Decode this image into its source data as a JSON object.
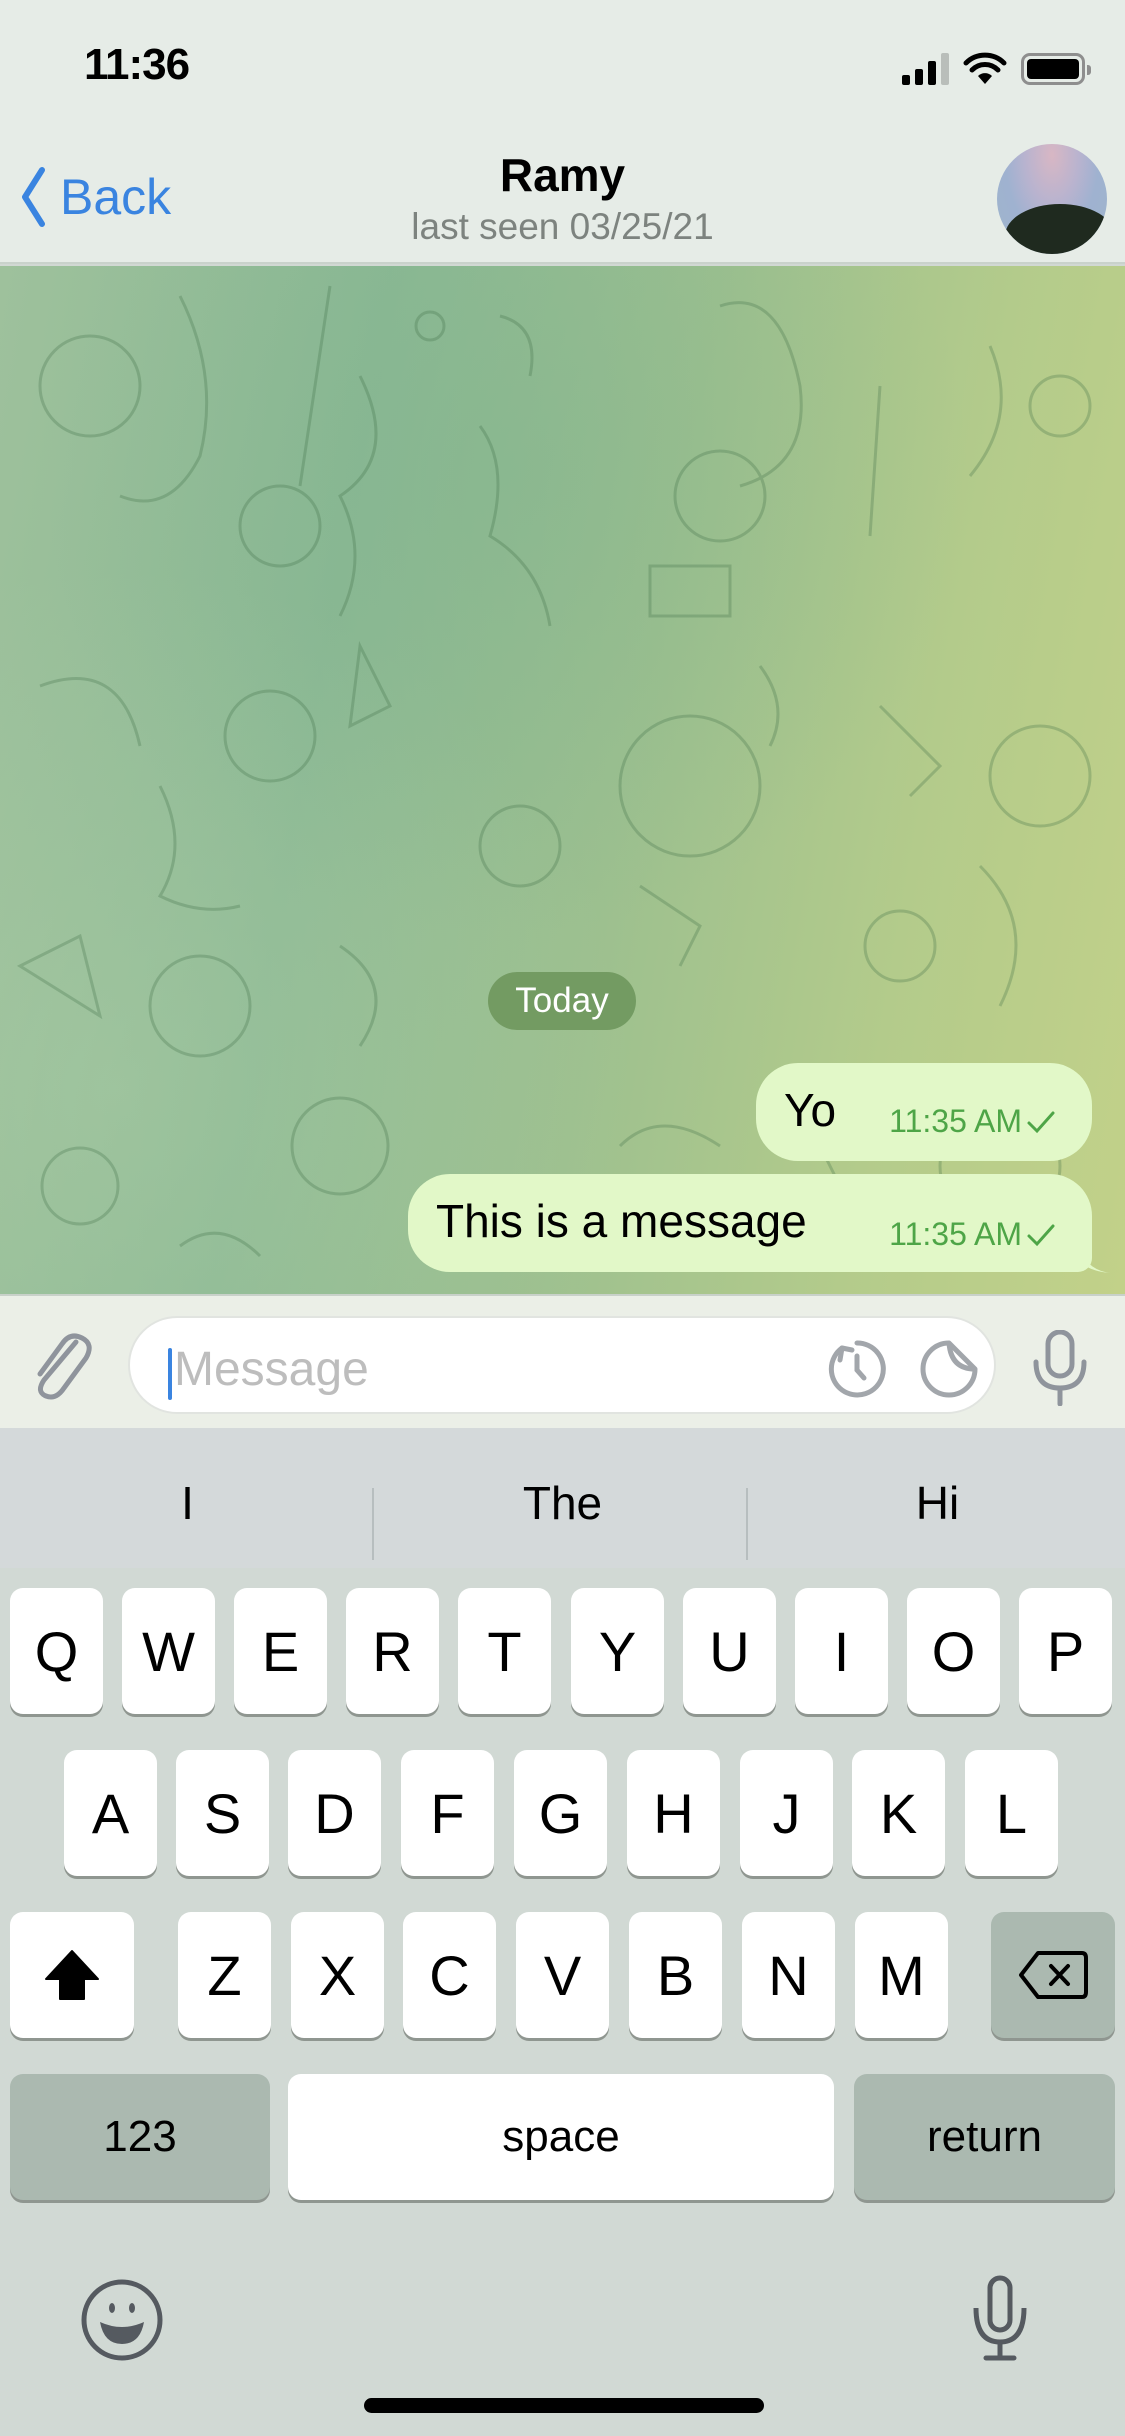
{
  "status_bar": {
    "time": "11:36",
    "icons": [
      "cellular-signal-icon",
      "wifi-icon",
      "battery-icon"
    ]
  },
  "header": {
    "back_label": "Back",
    "title": "Ramy",
    "subtitle": "last seen 03/25/21",
    "avatar": "contact-avatar"
  },
  "chat": {
    "date_separator": "Today",
    "messages": [
      {
        "text": "Yo",
        "time": "11:35 AM",
        "status": "sent",
        "outgoing": true
      },
      {
        "text": "This is a message",
        "time": "11:35 AM",
        "status": "sent",
        "outgoing": true
      }
    ],
    "colors": {
      "bubble_out": "#e2f8c8",
      "meta_green": "#4ea547",
      "date_pill": "#739b62"
    }
  },
  "composer": {
    "placeholder": "Message",
    "value": "",
    "icons": [
      "paperclip-icon",
      "timer-icon",
      "sticker-icon",
      "microphone-icon"
    ]
  },
  "keyboard": {
    "suggestions": [
      "I",
      "The",
      "Hi"
    ],
    "rows": [
      [
        "Q",
        "W",
        "E",
        "R",
        "T",
        "Y",
        "U",
        "I",
        "O",
        "P"
      ],
      [
        "A",
        "S",
        "D",
        "F",
        "G",
        "H",
        "J",
        "K",
        "L"
      ],
      [
        "Z",
        "X",
        "C",
        "V",
        "B",
        "N",
        "M"
      ]
    ],
    "numbers_label": "123",
    "space_label": "space",
    "return_label": "return"
  },
  "accent_color": "#3a84e0"
}
